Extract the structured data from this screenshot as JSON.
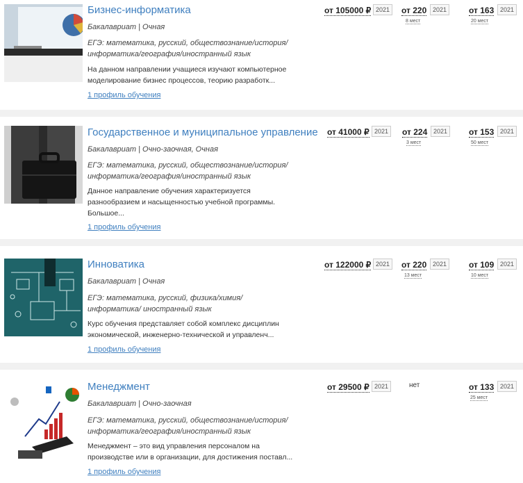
{
  "programs": [
    {
      "title": "Бизнес-информатика",
      "meta": "Бакалавриат | Очная",
      "ege": "ЕГЭ: математика, русский, обществознание/история/ информатика/география/иностранный язык",
      "description": "На данном направлении учащиеся изучают компьютерное моделирование бизнес процессов, теорию разработк...",
      "profile_link": "1 профиль обучения",
      "price": "от 105000 ₽",
      "price_year": "2021",
      "score1": "от 220",
      "score1_year": "2021",
      "score1_places": "8 мест",
      "score2": "от 163",
      "score2_year": "2021",
      "score2_places": "20 мест"
    },
    {
      "title": "Государственное и муниципальное управление",
      "meta": "Бакалавриат | Очно-заочная, Очная",
      "ege": "ЕГЭ: математика, русский, обществознание/история/ информатика/география/иностранный язык",
      "description": "Данное направление обучения характеризуется разнообразием и насыщенностью учебной программы. Большое...",
      "profile_link": "1 профиль обучения",
      "price": "от 41000 ₽",
      "price_year": "2021",
      "score1": "от 224",
      "score1_year": "2021",
      "score1_places": "3 мест",
      "score2": "от 153",
      "score2_year": "2021",
      "score2_places": "50 мест"
    },
    {
      "title": "Инноватика",
      "meta": "Бакалавриат | Очная",
      "ege": "ЕГЭ: математика, русский, физика/химия/информатика/ иностранный язык",
      "description": "Курс обучения представляет собой комплекс дисциплин экономической, инженерно-технической и управленч...",
      "profile_link": "1 профиль обучения",
      "price": "от 122000 ₽",
      "price_year": "2021",
      "score1": "от 220",
      "score1_year": "2021",
      "score1_places": "13 мест",
      "score2": "от 109",
      "score2_year": "2021",
      "score2_places": "10 мест"
    },
    {
      "title": "Менеджмент",
      "meta": "Бакалавриат | Очно-заочная",
      "ege": "ЕГЭ: математика, русский, обществознание/история/ информатика/география/иностранный язык",
      "description": "Менеджмент – это вид управления персоналом на производстве или в организации, для достижения поставл...",
      "profile_link": "1 профиль обучения",
      "price": "от 29500 ₽",
      "price_year": "2021",
      "score1_none": "нет",
      "score2": "от 133",
      "score2_year": "2021",
      "score2_places": "25 мест"
    }
  ]
}
